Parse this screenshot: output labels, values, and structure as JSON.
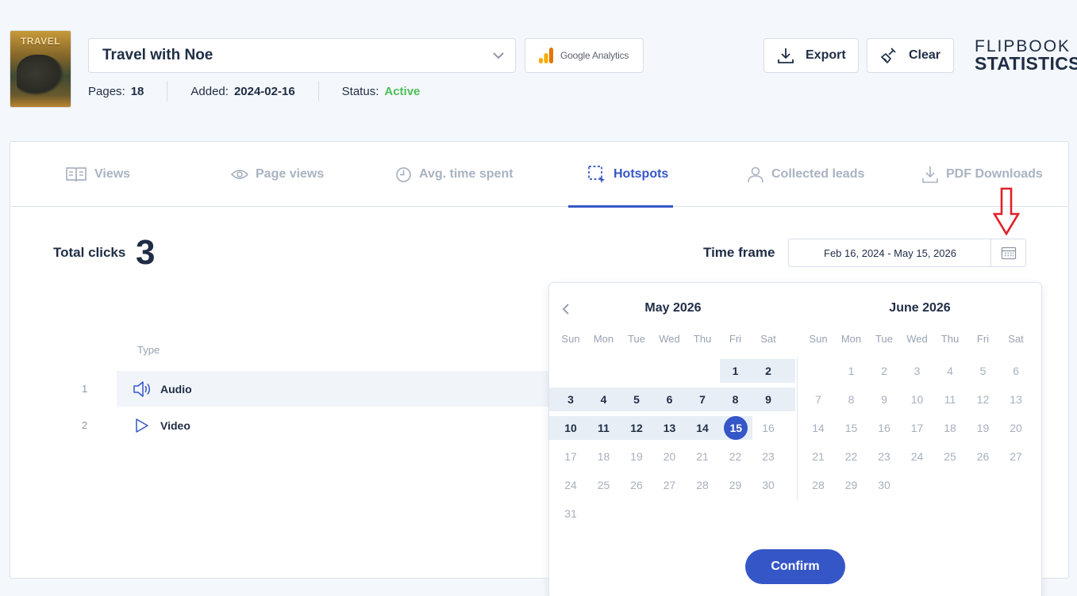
{
  "flipbook": {
    "cover_text": "TRAVEL",
    "title": "Travel with Noe",
    "pages_label": "Pages:",
    "pages_value": "18",
    "added_label": "Added:",
    "added_value": "2024-02-16",
    "status_label": "Status:",
    "status_value": "Active",
    "status_color": "#4cbf5a"
  },
  "header": {
    "google_analytics_label": "Google Analytics",
    "export_label": "Export",
    "clear_label": "Clear",
    "brand_line1": "FLIPBOOK",
    "brand_line2": "STATISTICS"
  },
  "tabs": [
    {
      "label": "Views",
      "icon": "views-icon"
    },
    {
      "label": "Page views",
      "icon": "eye-icon"
    },
    {
      "label": "Avg. time spent",
      "icon": "clock-icon"
    },
    {
      "label": "Hotspots",
      "icon": "hotspot-selection-icon",
      "active": true
    },
    {
      "label": "Collected leads",
      "icon": "user-icon"
    },
    {
      "label": "PDF Downloads",
      "icon": "download-icon"
    }
  ],
  "stats": {
    "total_clicks_label": "Total clicks",
    "total_clicks_value": "3",
    "time_frame_label": "Time frame",
    "time_frame_value": "Feb 16, 2024 - May 15, 2026"
  },
  "table": {
    "type_header": "Type",
    "rows": [
      {
        "index": "1",
        "type": "Audio",
        "icon": "speaker-icon"
      },
      {
        "index": "2",
        "type": "Video",
        "icon": "play-icon"
      }
    ]
  },
  "calendar": {
    "left_month": "May 2026",
    "right_month": "June 2026",
    "weekdays": [
      "Sun",
      "Mon",
      "Tue",
      "Wed",
      "Thu",
      "Fri",
      "Sat"
    ],
    "left_days": [
      "1",
      "2",
      "3",
      "4",
      "5",
      "6",
      "7",
      "8",
      "9",
      "10",
      "11",
      "12",
      "13",
      "14",
      "15",
      "16",
      "17",
      "18",
      "19",
      "20",
      "21",
      "22",
      "23",
      "24",
      "25",
      "26",
      "27",
      "28",
      "29",
      "30",
      "31"
    ],
    "right_days": [
      "1",
      "2",
      "3",
      "4",
      "5",
      "6",
      "7",
      "8",
      "9",
      "10",
      "11",
      "12",
      "13",
      "14",
      "15",
      "16",
      "17",
      "18",
      "19",
      "20",
      "21",
      "22",
      "23",
      "24",
      "25",
      "26",
      "27",
      "28",
      "29",
      "30"
    ],
    "selected_day": "15",
    "confirm_label": "Confirm"
  },
  "colors": {
    "accent": "#3556c7",
    "annotation_arrow": "#e0202a"
  }
}
